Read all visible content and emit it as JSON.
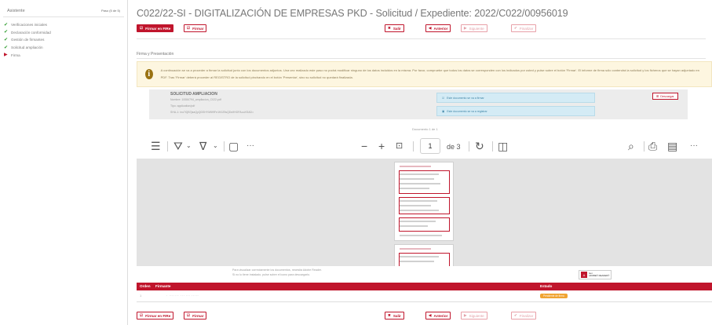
{
  "sidebar": {
    "title": "Asistente",
    "step": "Paso (5 de 5)",
    "items": [
      {
        "label": "Verificaciones iniciales",
        "status": "done"
      },
      {
        "label": "Declaración conformidad",
        "status": "done"
      },
      {
        "label": "Gestión de firmantes",
        "status": "done"
      },
      {
        "label": "Solicitud ampliación",
        "status": "done"
      },
      {
        "label": "Firma",
        "status": "current"
      }
    ]
  },
  "header": {
    "title": "C022/22-SI - DIGITALIZACIÓN DE EMPRESAS PKD - Solicitud / Expediente: 2022/C022/00956019"
  },
  "toolbar": {
    "firmar_fifa": "Firmar en FIRe",
    "firmar": "Firmar",
    "salir": "Salir",
    "anterior": "Anterior",
    "siguiente": "Siguiente",
    "finalizar": "Finalizar"
  },
  "section_title": "Firma y Presentación",
  "warning_text": "A continuación se va a proceder a firmar la solicitud junto con los documentos adjuntos. Una vez realizado este paso no podrá modificar ninguno de los datos incluidos en la misma. Por favor, compruebe que todos los datos se corresponden con los indicados por usted y pulse sobre el botón 'Firmar'. El informe de firma sólo contendrá la solicitud y los ficheros que se hayan adjuntado en PDF. Tras 'Firmar' deberá proceder al REGISTRO de la solicitud pinchando en el botón 'Presentar', sino su solicitud no quedará finalizada.",
  "document": {
    "name": "SOLICITUD AMPLIACION",
    "meta1": "Nombre: 10084794_ampliacion_C022.pdf",
    "meta2": "Tipo: application/pdf",
    "meta3": "SHA-1: ino7iQB7jaaQyQDSHYM5f9Fe1K0Z5sQDs9HOFAuuXSAD=",
    "status_sign": "Este documento se va a firmar",
    "status_register": "Este documento se va a registrar",
    "download": "Descargar"
  },
  "doc_counter": "Documento 1 de 1",
  "pdf_toolbar": {
    "page": "1",
    "of_pages": "de 3",
    "more": "···",
    "minus": "−",
    "plus": "+"
  },
  "adobe_note": {
    "line1": "Para visualizar correctamente los documentos, necesita Adobe Reader.",
    "line2": "Si no lo tiene instalado, pulse sobre el icono para descargarlo.",
    "badge_line1": "Get",
    "badge_line2": "ADOBE® READER®"
  },
  "signers_table": {
    "headers": [
      "Orden",
      "Firmante",
      "Estado"
    ],
    "rows": [
      {
        "orden": "1",
        "firmante": "· ·······  ··· ··· ·····",
        "estado": "Pendiente de firma"
      }
    ]
  },
  "colors": {
    "accent": "#c0152c",
    "warning_bg": "#fdf6e0",
    "info": "#d4ebf5",
    "pending": "#f0a432"
  }
}
